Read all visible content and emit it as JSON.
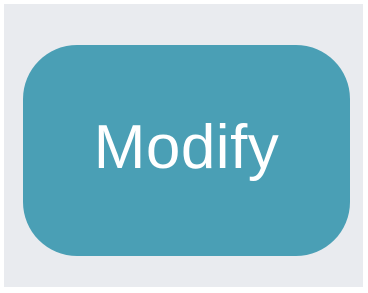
{
  "button": {
    "label": "Modify"
  },
  "colors": {
    "background": "#e9ebef",
    "button_fill": "#4a9fb5",
    "button_text": "#ffffff"
  }
}
